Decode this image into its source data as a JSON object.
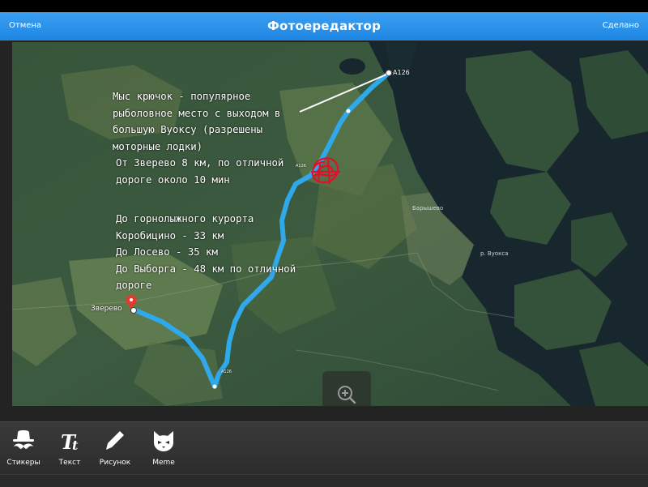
{
  "nav": {
    "cancel": "Отмена",
    "title": "Фотоередактор",
    "done": "Сделано",
    "bar_color": "#1e86e3"
  },
  "map": {
    "route_color": "#2fa9ea",
    "annotation_color": "#e0102b",
    "road_label_start": "A126",
    "road_label_mid": "A126",
    "road_label_end": "A126",
    "start_town": "Зверево",
    "village_label": "Барышево",
    "river_label": "р. Вуокса",
    "notes": [
      {
        "lines": [
          "Мыс крючок - популярное",
          "рыболовное место с выходом в",
          "большую Вуоксу (разрешены",
          "моторные лодки)"
        ]
      },
      {
        "lines": [
          "От Зверево 8 км, по отличной",
          "дороге около 10 мин"
        ]
      },
      {
        "lines": [
          "До горнолыжного курорта",
          "Коробицино - 33 км",
          "До Лосево - 35 км",
          "До Выборга - 48 км по отличной",
          "дороге"
        ]
      }
    ],
    "zoom_icon": "zoom-in-icon"
  },
  "toolbar": {
    "items": [
      {
        "label": "Стикеры",
        "icon": "mustache-hat-icon"
      },
      {
        "label": "Текст",
        "icon": "text-tt-icon"
      },
      {
        "label": "Рисунок",
        "icon": "pencil-icon"
      },
      {
        "label": "Meme",
        "icon": "cat-face-icon"
      }
    ]
  }
}
